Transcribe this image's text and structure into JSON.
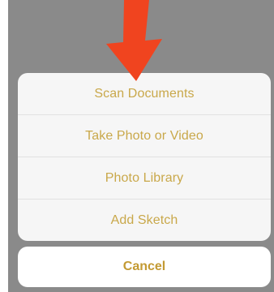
{
  "action_sheet": {
    "items": [
      {
        "label": "Scan Documents"
      },
      {
        "label": "Take Photo or Video"
      },
      {
        "label": "Photo Library"
      },
      {
        "label": "Add Sketch"
      }
    ],
    "cancel_label": "Cancel"
  },
  "colors": {
    "item_text": "#c9a84a",
    "cancel_text": "#c39a33",
    "backdrop": "#8a8a8a",
    "arrow": "#f0441f"
  },
  "icons": {
    "pointer": "down-arrow-icon"
  }
}
